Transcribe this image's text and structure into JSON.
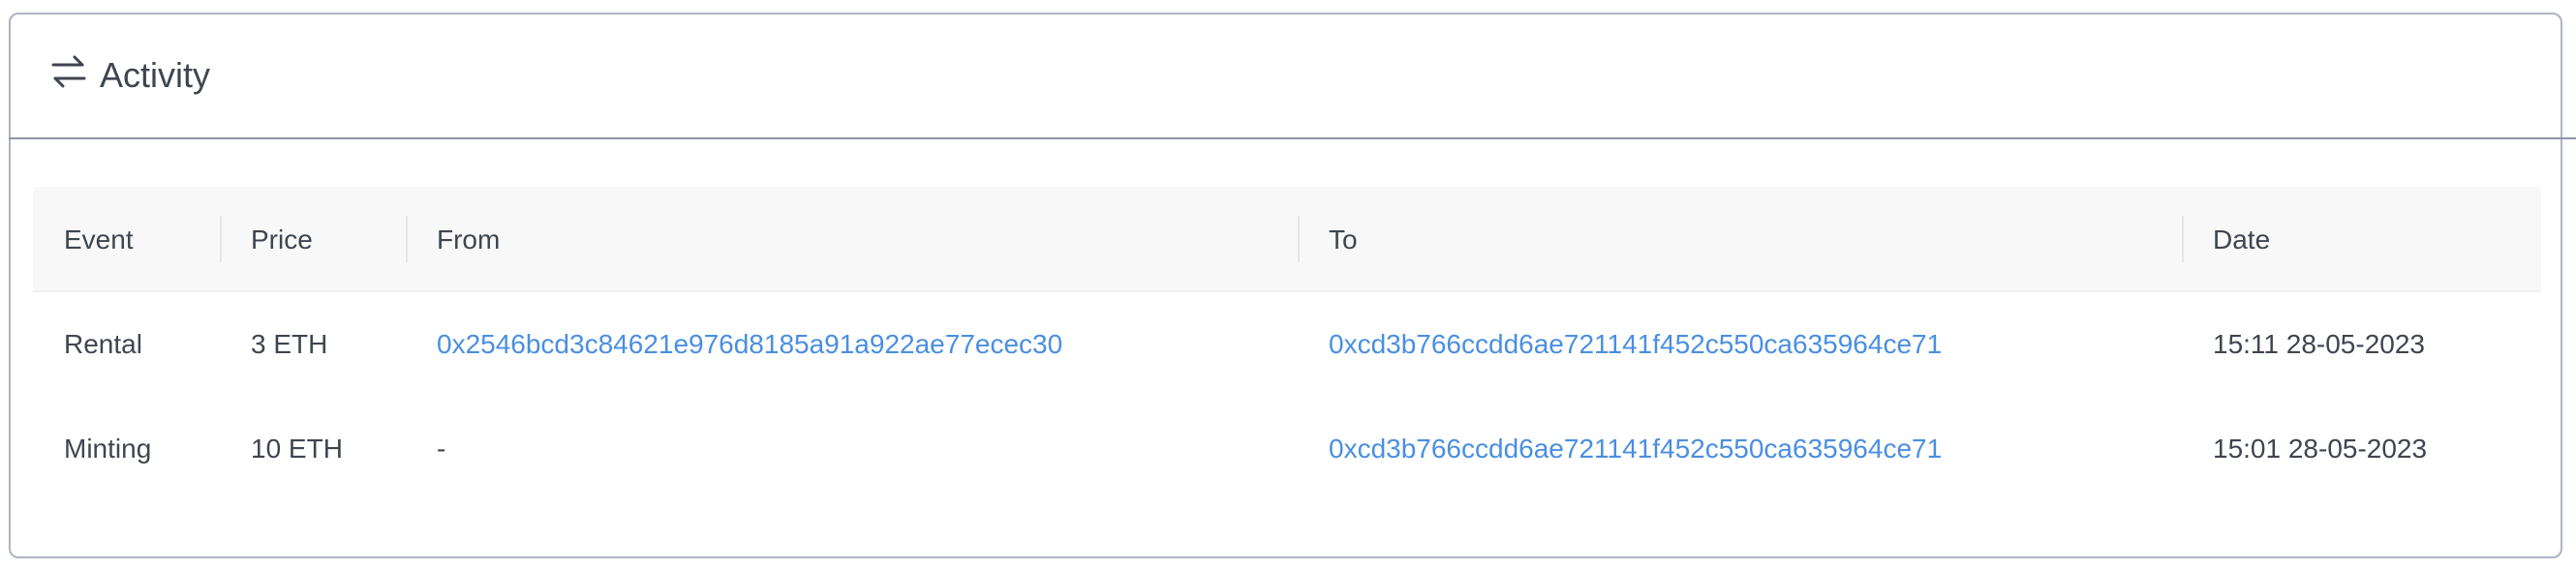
{
  "panel": {
    "title": "Activity",
    "icon": "arrows-swap-icon"
  },
  "table": {
    "columns": [
      "Event",
      "Price",
      "From",
      "To",
      "Date"
    ],
    "rows": [
      {
        "event": "Rental",
        "price": "3 ETH",
        "from": "0x2546bcd3c84621e976d8185a91a922ae77ecec30",
        "to": "0xcd3b766ccdd6ae721141f452c550ca635964ce71",
        "date": "15:11 28-05-2023"
      },
      {
        "event": "Minting",
        "price": "10 ETH",
        "from": "-",
        "to": "0xcd3b766ccdd6ae721141f452c550ca635964ce71",
        "date": "15:01 28-05-2023"
      }
    ]
  },
  "colors": {
    "link": "#4a8fe0",
    "text": "#3f4550",
    "border": "#aeb4c2",
    "header_bg": "#f8f8f8"
  }
}
